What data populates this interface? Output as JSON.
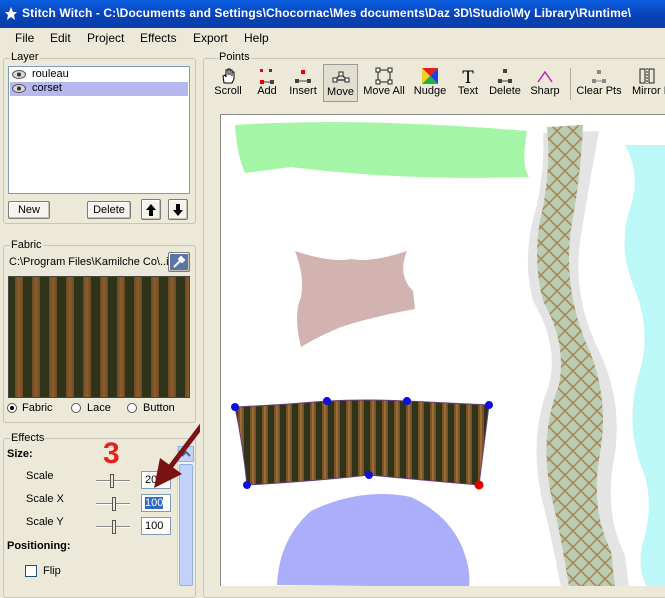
{
  "window": {
    "title": "Stitch Witch - C:\\Documents and Settings\\Chocornac\\Mes documents\\Daz 3D\\Studio\\My Library\\Runtime\\"
  },
  "menu": [
    "File",
    "Edit",
    "Project",
    "Effects",
    "Export",
    "Help"
  ],
  "layer": {
    "label": "Layer",
    "items": [
      {
        "name": "rouleau",
        "selected": false
      },
      {
        "name": "corset",
        "selected": true
      }
    ],
    "new_button": "New",
    "delete_button": "Delete"
  },
  "fabric": {
    "label": "Fabric",
    "path": "C:\\Program Files\\Kamilche Co\\..ing",
    "options": [
      "Fabric",
      "Lace",
      "Button"
    ],
    "selected": "Fabric"
  },
  "effects": {
    "label": "Effects",
    "size_label": "Size:",
    "scale": {
      "label": "Scale",
      "value": "20"
    },
    "scale_x": {
      "label": "Scale X",
      "value": "100"
    },
    "scale_y": {
      "label": "Scale Y",
      "value": "100"
    },
    "positioning_label": "Positioning:",
    "flip": {
      "label": "Flip",
      "checked": false
    }
  },
  "annotation": {
    "step": "3",
    "color": "#e8211d",
    "arrow_color": "#7a1414"
  },
  "points": {
    "label": "Points",
    "tools": [
      {
        "label": "Scroll",
        "icon": "hand-icon"
      },
      {
        "label": "Add",
        "icon": "add-point-icon"
      },
      {
        "label": "Insert",
        "icon": "insert-point-icon"
      },
      {
        "label": "Move",
        "icon": "move-point-icon",
        "active": true
      },
      {
        "label": "Move All",
        "icon": "move-all-icon"
      },
      {
        "label": "Nudge",
        "icon": "nudge-icon"
      },
      {
        "label": "Text",
        "icon": "text-icon"
      },
      {
        "label": "Delete",
        "icon": "delete-point-icon"
      },
      {
        "label": "Sharp",
        "icon": "sharp-icon"
      },
      {
        "label": "Clear Pts",
        "icon": "clear-points-icon"
      },
      {
        "label": "Mirror P",
        "icon": "mirror-icon"
      }
    ]
  },
  "colors": {
    "titlebar": "#0842b8",
    "selection": "#b8b8f0",
    "shape_green": "#a5f5a6",
    "shape_pink": "#d2b3b0",
    "shape_blue": "#aaaefb",
    "shape_cyan": "#bdf8f8",
    "point_blue": "#1010e0",
    "point_red": "#e00000"
  }
}
